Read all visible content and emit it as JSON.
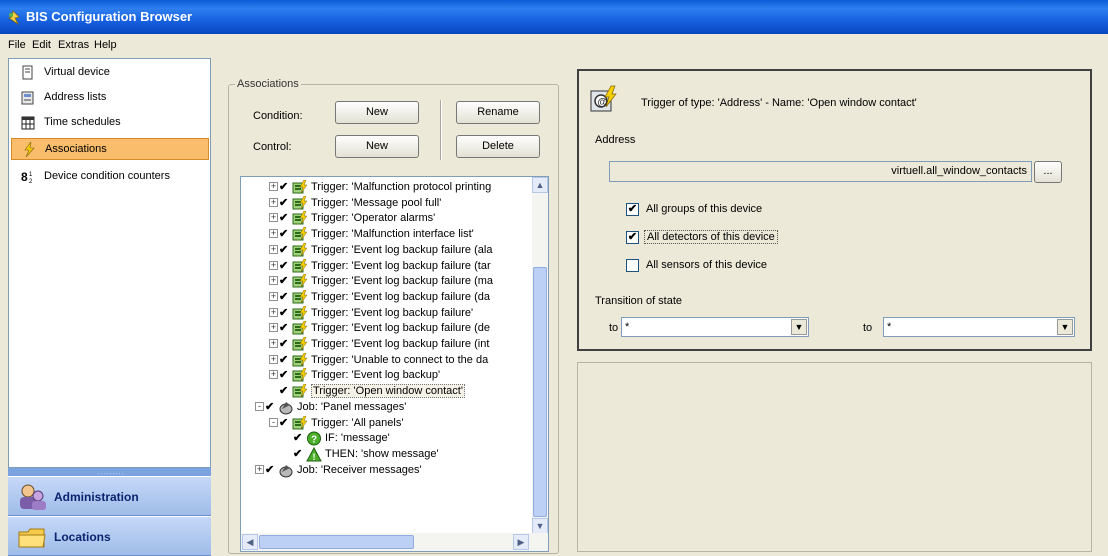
{
  "window": {
    "title": "BIS Configuration Browser"
  },
  "menu": {
    "file": "File",
    "edit": "Edit",
    "extras": "Extras",
    "help": "Help"
  },
  "nav": {
    "items": [
      {
        "label": "Virtual device",
        "icon": "virtual-device-icon",
        "selected": false
      },
      {
        "label": "Address lists",
        "icon": "address-list-icon",
        "selected": false
      },
      {
        "label": "Time schedules",
        "icon": "calendar-icon",
        "selected": false
      },
      {
        "label": "Associations",
        "icon": "lightning-icon",
        "selected": true
      },
      {
        "label": "Device condition counters",
        "icon": "counter-icon",
        "selected": false
      }
    ],
    "bottom_buttons": [
      {
        "label": "Administration",
        "icon": "administration-icon"
      },
      {
        "label": "Locations",
        "icon": "folder-icon"
      }
    ]
  },
  "associations": {
    "group_title": "Associations",
    "condition_label": "Condition:",
    "control_label": "Control:",
    "new_label": "New",
    "rename_label": "Rename",
    "delete_label": "Delete"
  },
  "tree": {
    "rows": [
      {
        "indent": 1,
        "expand": "+",
        "checked": true,
        "icon": "trigger-icon",
        "text": "Trigger: 'Malfunction protocol printing"
      },
      {
        "indent": 1,
        "expand": "+",
        "checked": true,
        "icon": "trigger-icon",
        "text": "Trigger: 'Message pool full'"
      },
      {
        "indent": 1,
        "expand": "+",
        "checked": true,
        "icon": "trigger-icon",
        "text": "Trigger: 'Operator alarms'"
      },
      {
        "indent": 1,
        "expand": "+",
        "checked": true,
        "icon": "trigger-icon",
        "text": "Trigger: 'Malfunction interface list'"
      },
      {
        "indent": 1,
        "expand": "+",
        "checked": true,
        "icon": "trigger-icon",
        "text": "Trigger: 'Event log backup failure (ala"
      },
      {
        "indent": 1,
        "expand": "+",
        "checked": true,
        "icon": "trigger-icon",
        "text": "Trigger: 'Event log backup failure (tar"
      },
      {
        "indent": 1,
        "expand": "+",
        "checked": true,
        "icon": "trigger-icon",
        "text": "Trigger: 'Event log backup failure (ma"
      },
      {
        "indent": 1,
        "expand": "+",
        "checked": true,
        "icon": "trigger-icon",
        "text": "Trigger: 'Event log backup failure (da"
      },
      {
        "indent": 1,
        "expand": "+",
        "checked": true,
        "icon": "trigger-icon",
        "text": "Trigger: 'Event log backup failure'"
      },
      {
        "indent": 1,
        "expand": "+",
        "checked": true,
        "icon": "trigger-icon",
        "text": "Trigger: 'Event log backup failure (de"
      },
      {
        "indent": 1,
        "expand": "+",
        "checked": true,
        "icon": "trigger-icon",
        "text": "Trigger: 'Event log backup failure (int"
      },
      {
        "indent": 1,
        "expand": "+",
        "checked": true,
        "icon": "trigger-icon",
        "text": "Trigger: 'Unable to connect to the da"
      },
      {
        "indent": 1,
        "expand": "+",
        "checked": true,
        "icon": "trigger-icon",
        "text": "Trigger: 'Event log backup'"
      },
      {
        "indent": 1,
        "expand": "",
        "checked": true,
        "icon": "trigger-icon",
        "text": "Trigger: 'Open window contact'",
        "selected": true
      },
      {
        "indent": 0,
        "expand": "-",
        "checked": true,
        "icon": "job-icon",
        "text": "Job: 'Panel messages'"
      },
      {
        "indent": 1,
        "expand": "-",
        "checked": true,
        "icon": "trigger-icon",
        "text": "Trigger: 'All panels'"
      },
      {
        "indent": 2,
        "expand": "",
        "checked": true,
        "icon": "if-icon",
        "text": "IF: 'message'"
      },
      {
        "indent": 2,
        "expand": "",
        "checked": true,
        "icon": "then-icon",
        "text": "THEN: 'show message'"
      },
      {
        "indent": 0,
        "expand": "+",
        "checked": true,
        "icon": "job-icon",
        "text": "Job: 'Receiver messages'"
      }
    ]
  },
  "detail": {
    "header": "Trigger of type: 'Address'  -  Name: 'Open window contact'",
    "address_label": "Address",
    "address_value": "virtuell.all_window_contacts",
    "browse_label": "...",
    "options": [
      {
        "label": "All groups of this device",
        "checked": true
      },
      {
        "label": "All detectors of this device",
        "checked": true,
        "focused": true
      },
      {
        "label": "All sensors of this device",
        "checked": false
      }
    ],
    "transition_label": "Transition of state",
    "to_label": "to",
    "from_value": "*",
    "to_value": "*"
  },
  "colors": {
    "title_bar": "#1761e0",
    "selection": "#f9bd6c",
    "nav_button": "#9ebce8"
  }
}
